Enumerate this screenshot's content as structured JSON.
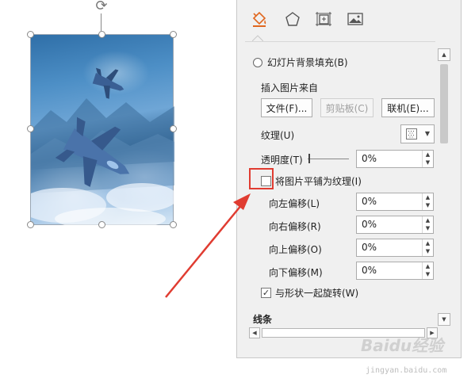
{
  "panel": {
    "tabs": [
      {
        "name": "fill-line",
        "icon": "paint-bucket-icon",
        "active": true
      },
      {
        "name": "effects",
        "icon": "pentagon-icon"
      },
      {
        "name": "size-properties",
        "icon": "size-properties-icon"
      },
      {
        "name": "picture",
        "icon": "picture-icon"
      }
    ],
    "slide_bg_fill_label": "幻灯片背景填充(B)",
    "insert_from_label": "插入图片来自",
    "file_button": "文件(F)...",
    "clipboard_button": "剪贴板(C)",
    "online_button": "联机(E)...",
    "texture_label": "纹理(U)",
    "transparency_label": "透明度(T)",
    "transparency_value": "0%",
    "tile_label": "将图片平铺为纹理(I)",
    "tile_checked": false,
    "offset_left_label": "向左偏移(L)",
    "offset_left_value": "0%",
    "offset_right_label": "向右偏移(R)",
    "offset_right_value": "0%",
    "offset_top_label": "向上偏移(O)",
    "offset_top_value": "0%",
    "offset_bottom_label": "向下偏移(M)",
    "offset_bottom_value": "0%",
    "rotate_with_shape_label": "与形状一起旋转(W)",
    "rotate_with_shape_checked": true,
    "line_section_label": "线条"
  },
  "colors": {
    "highlight": "#e03c31",
    "accent": "#d9534f"
  },
  "watermark": {
    "brand": "Baidu经验",
    "url": "jingyan.baidu.com"
  }
}
